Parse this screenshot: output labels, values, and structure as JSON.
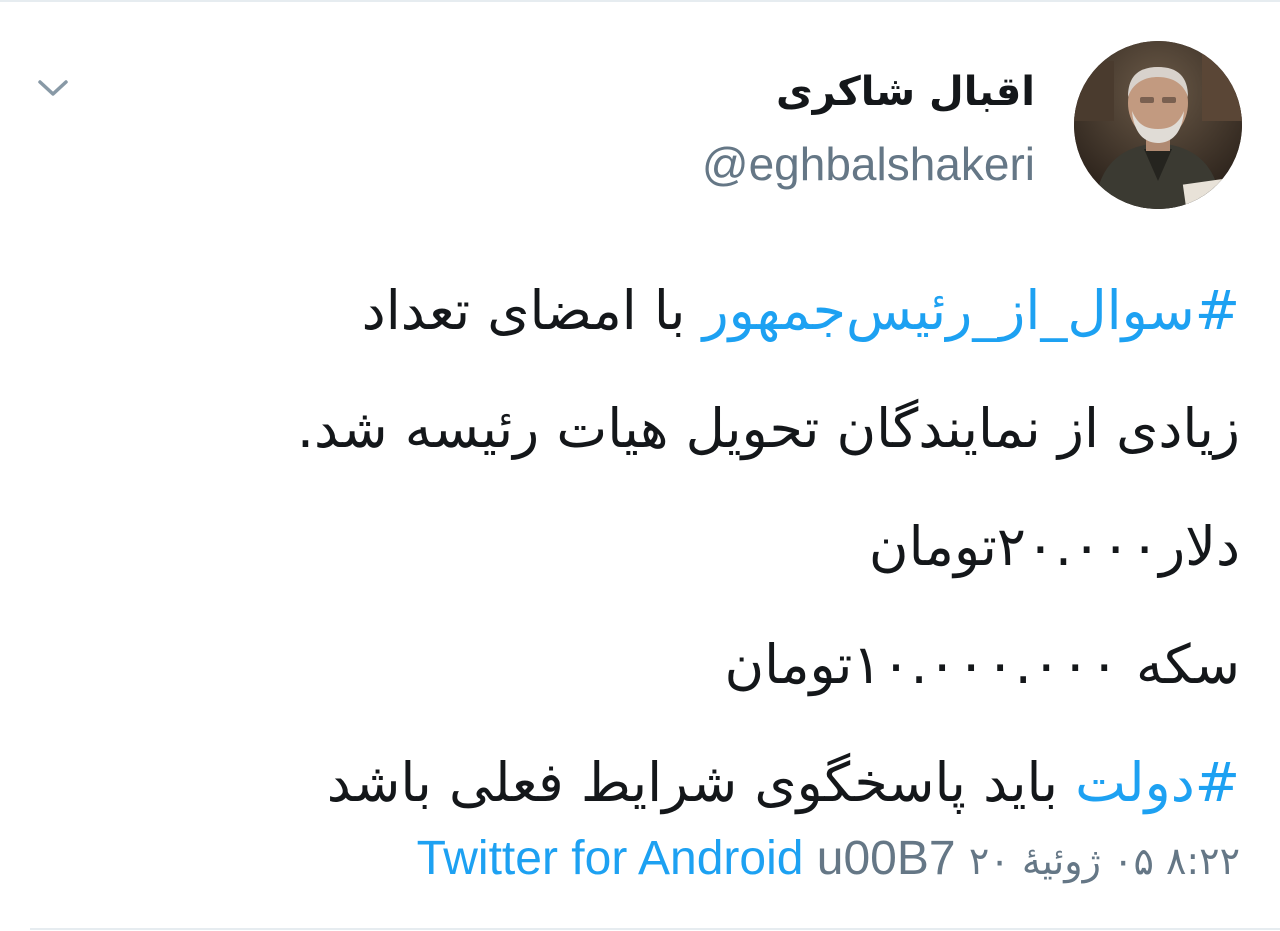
{
  "tweet": {
    "author": {
      "display_name": "اقبال شاکری",
      "handle": "@eghbalshakeri",
      "avatar": "profile-photo"
    },
    "menu_icon": "chevron-down-icon",
    "body_lines": [
      {
        "hashtag": "#سوال_از_رئیس‌جمهور",
        "text": " با امضای تعداد"
      },
      {
        "hashtag": "",
        "text": "زیادی از نمایندگان تحویل هیات رئیسه شد."
      },
      {
        "hashtag": "",
        "text": "دلار۲۰.۰۰۰تومان"
      },
      {
        "hashtag": "",
        "text": "سکه ۱۰.۰۰۰.۰۰۰تومان"
      },
      {
        "hashtag": "#دولت",
        "text": " باید پاسخگوی شرایط فعلی باشد"
      }
    ],
    "meta": {
      "time": "۸:۲۲ ۰۵ ژوئیهٔ ۲۰",
      "separator": "u00B7",
      "source": "Twitter for Android"
    },
    "colors": {
      "link": "#1da1f2",
      "text": "#14171a",
      "secondary": "#657786",
      "divider": "#e6ecf0"
    }
  }
}
